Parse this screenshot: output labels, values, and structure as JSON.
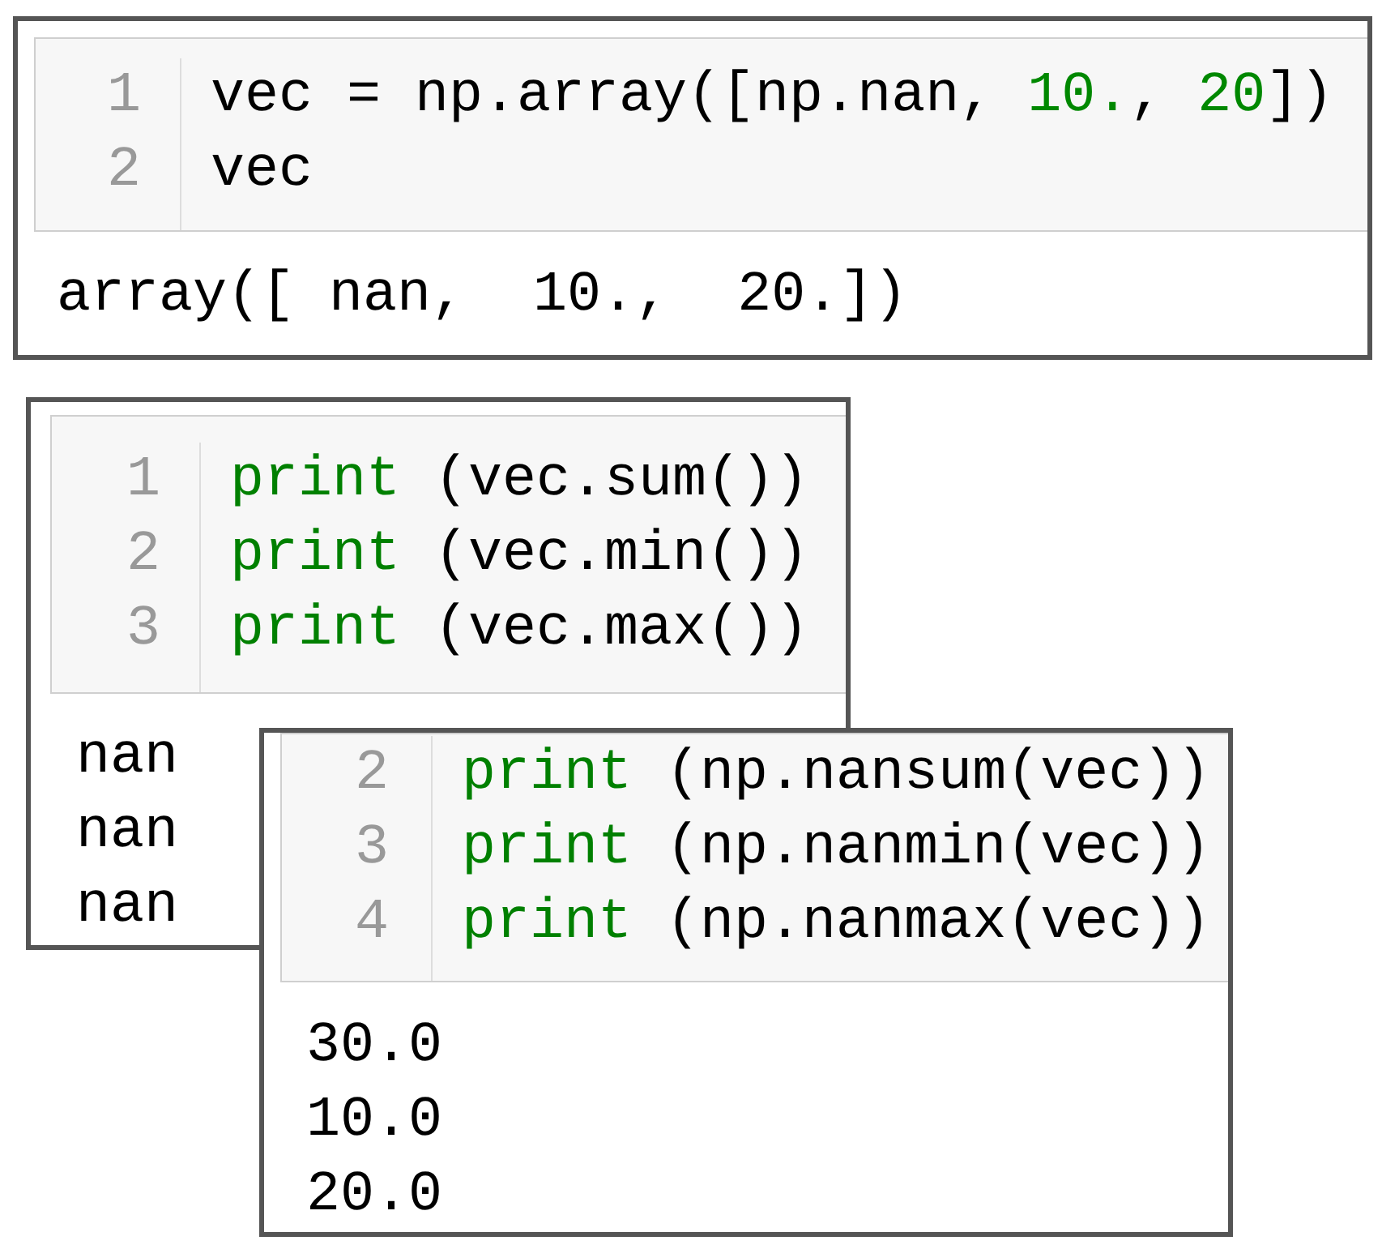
{
  "cells": [
    {
      "lines": [
        {
          "number": "1",
          "tokens": [
            {
              "text": "vec = np.array([np.nan, ",
              "kind": "plain"
            },
            {
              "text": "10.",
              "kind": "number"
            },
            {
              "text": ", ",
              "kind": "plain"
            },
            {
              "text": "20",
              "kind": "number"
            },
            {
              "text": "])",
              "kind": "plain"
            }
          ]
        },
        {
          "number": "2",
          "tokens": [
            {
              "text": "vec",
              "kind": "plain"
            }
          ]
        }
      ],
      "output": [
        "array([ nan,  10.,  20.])"
      ]
    },
    {
      "lines": [
        {
          "number": "1",
          "tokens": [
            {
              "text": "print",
              "kind": "keyword"
            },
            {
              "text": " (vec.sum())",
              "kind": "plain"
            }
          ]
        },
        {
          "number": "2",
          "tokens": [
            {
              "text": "print",
              "kind": "keyword"
            },
            {
              "text": " (vec.min())",
              "kind": "plain"
            }
          ]
        },
        {
          "number": "3",
          "tokens": [
            {
              "text": "print",
              "kind": "keyword"
            },
            {
              "text": " (vec.max())",
              "kind": "plain"
            }
          ]
        }
      ],
      "output": [
        "nan",
        "nan",
        "nan"
      ]
    },
    {
      "lines": [
        {
          "number": "2",
          "tokens": [
            {
              "text": "print",
              "kind": "keyword"
            },
            {
              "text": " (np.nansum(vec))",
              "kind": "plain"
            }
          ]
        },
        {
          "number": "3",
          "tokens": [
            {
              "text": "print",
              "kind": "keyword"
            },
            {
              "text": " (np.nanmin(vec))",
              "kind": "plain"
            }
          ]
        },
        {
          "number": "4",
          "tokens": [
            {
              "text": "print",
              "kind": "keyword"
            },
            {
              "text": " (np.nanmax(vec))",
              "kind": "plain"
            }
          ]
        }
      ],
      "output": [
        "30.0",
        "10.0",
        "20.0"
      ]
    }
  ]
}
